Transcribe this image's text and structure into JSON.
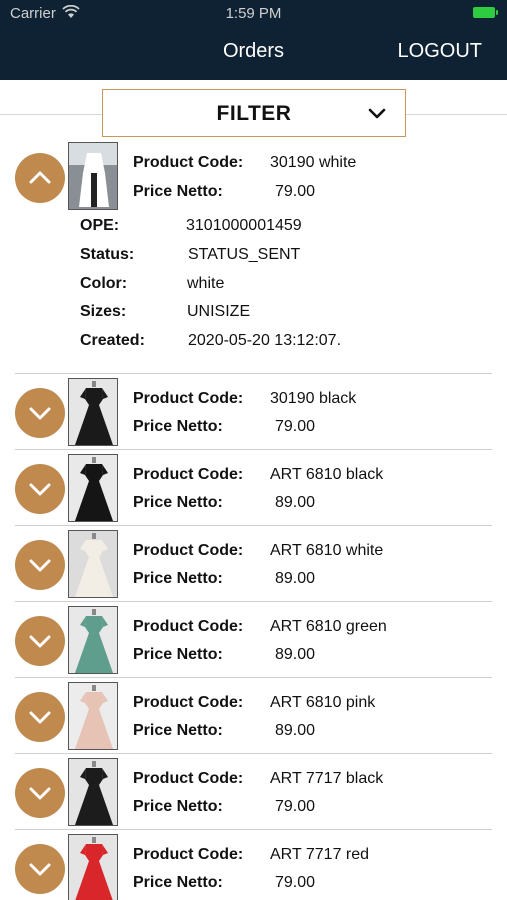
{
  "status_bar": {
    "carrier": "Carrier",
    "time": "1:59 PM"
  },
  "nav": {
    "title": "Orders",
    "logout": "LOGOUT"
  },
  "filter": {
    "label": "FILTER"
  },
  "labels": {
    "product_code": "Product Code:",
    "price_netto": "Price Netto:",
    "ope": "OPE:",
    "status": "Status:",
    "color": "Color:",
    "sizes": "Sizes:",
    "created": "Created:"
  },
  "expanded": {
    "product_code": "30190 white",
    "price": "79.00",
    "ope": "3101000001459",
    "status": "STATUS_SENT",
    "color": "white",
    "sizes": "UNISIZE",
    "created": "2020-05-20 13:12:07."
  },
  "orders": [
    {
      "product_code": "30190 black",
      "price": "79.00",
      "dress_color": "#1a1a1a",
      "bg": "#e6e6e6"
    },
    {
      "product_code": "ART 6810 black",
      "price": "89.00",
      "dress_color": "#151515",
      "bg": "#e9e9e9"
    },
    {
      "product_code": "ART 6810 white",
      "price": "89.00",
      "dress_color": "#f2eee6",
      "bg": "#dcdcdc"
    },
    {
      "product_code": "ART 6810 green",
      "price": "89.00",
      "dress_color": "#5f9e8c",
      "bg": "#e8e8e8"
    },
    {
      "product_code": "ART 6810 pink",
      "price": "89.00",
      "dress_color": "#e7c3b6",
      "bg": "#ececec"
    },
    {
      "product_code": "ART 7717 black",
      "price": "79.00",
      "dress_color": "#1c1c1c",
      "bg": "#e4e4e4"
    },
    {
      "product_code": "ART 7717 red",
      "price": "79.00",
      "dress_color": "#d8262a",
      "bg": "#e4e4e4"
    }
  ],
  "colors": {
    "header": "#0f2233",
    "accent": "#c08a4f",
    "filter_border": "#c8955a"
  }
}
